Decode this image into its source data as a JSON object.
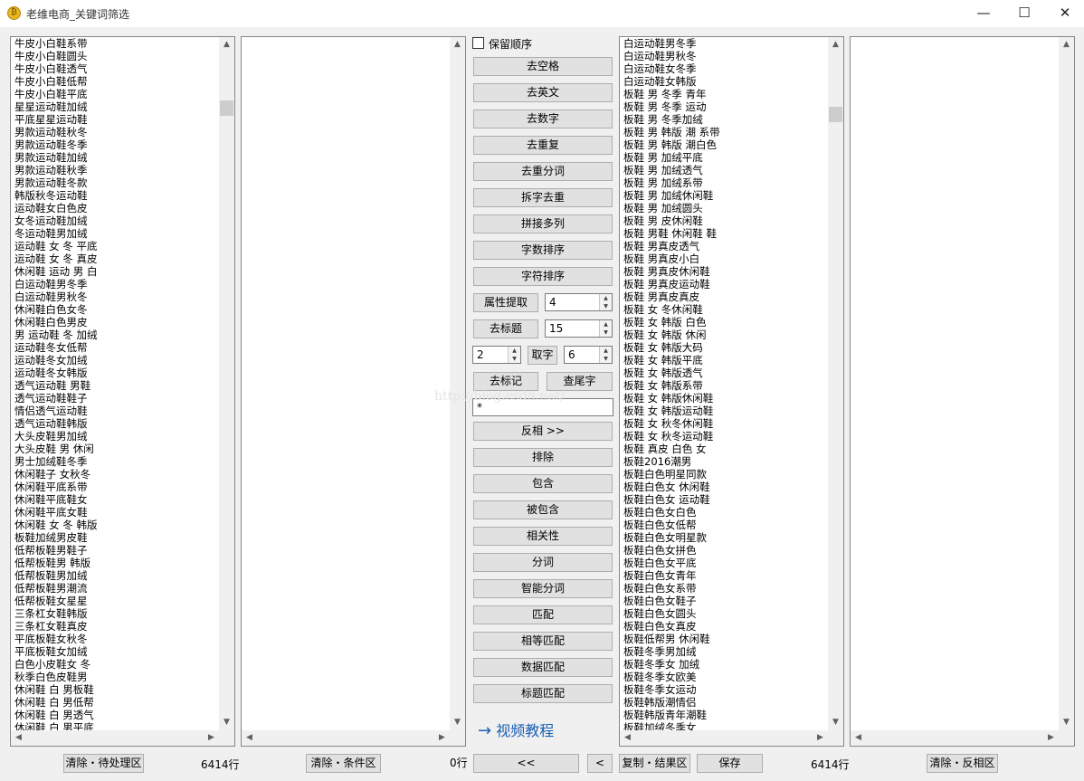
{
  "window": {
    "title": "老维电商_关键词筛选",
    "icon": "app-logo-icon",
    "minimize": "—",
    "maximize": "☐",
    "close": "✕"
  },
  "left_list": {
    "items": [
      "牛皮小白鞋系带",
      "牛皮小白鞋圆头",
      "牛皮小白鞋透气",
      "牛皮小白鞋低帮",
      "牛皮小白鞋平底",
      "星星运动鞋加绒",
      "平底星星运动鞋",
      "男款运动鞋秋冬",
      "男款运动鞋冬季",
      "男款运动鞋加绒",
      "男款运动鞋秋季",
      "男款运动鞋冬款",
      "韩版秋冬运动鞋",
      "运动鞋女白色皮",
      "女冬运动鞋加绒",
      "冬运动鞋男加绒",
      "运动鞋 女 冬 平底",
      "运动鞋 女 冬 真皮",
      "休闲鞋 运动 男 白",
      "白运动鞋男冬季",
      "白运动鞋男秋冬",
      "休闲鞋白色女冬",
      "休闲鞋白色男皮",
      "男 运动鞋 冬 加绒",
      "运动鞋冬女低帮",
      "运动鞋冬女加绒",
      "运动鞋冬女韩版",
      "透气运动鞋 男鞋",
      "透气运动鞋鞋子",
      "情侣透气运动鞋",
      "透气运动鞋韩版",
      "大头皮鞋男加绒",
      "大头皮鞋 男 休闲",
      "男士加绒鞋冬季",
      "休闲鞋子 女秋冬",
      "休闲鞋平底系带",
      "休闲鞋平底鞋女",
      "休闲鞋平底女鞋",
      "休闲鞋 女 冬 韩版",
      "板鞋加绒男皮鞋",
      "低帮板鞋男鞋子",
      "低帮板鞋男 韩版",
      "低帮板鞋男加绒",
      "低帮板鞋男潮流",
      "低帮板鞋女星星",
      "三条杠女鞋韩版",
      "三条杠女鞋真皮",
      "平底板鞋女秋冬",
      "平底板鞋女加绒",
      "白色小皮鞋女 冬",
      "秋季白色皮鞋男",
      "休闲鞋 白 男板鞋",
      "休闲鞋 白 男低帮",
      "休闲鞋 白 男透气",
      "休闲鞋 白 男平底"
    ]
  },
  "right_list": {
    "items": [
      "白运动鞋男冬季",
      "白运动鞋男秋冬",
      "白运动鞋女冬季",
      "白运动鞋女韩版",
      "板鞋 男 冬季 青年",
      "板鞋 男 冬季 运动",
      "板鞋 男 冬季加绒",
      "板鞋 男 韩版 潮 系带",
      "板鞋 男 韩版 潮白色",
      "板鞋 男 加绒平底",
      "板鞋 男 加绒透气",
      "板鞋 男 加绒系带",
      "板鞋 男 加绒休闲鞋",
      "板鞋 男 加绒圆头",
      "板鞋 男 皮休闲鞋",
      "板鞋 男鞋 休闲鞋 鞋",
      "板鞋 男真皮透气",
      "板鞋 男真皮小白",
      "板鞋 男真皮休闲鞋",
      "板鞋 男真皮运动鞋",
      "板鞋 男真皮真皮",
      "板鞋 女 冬休闲鞋",
      "板鞋 女 韩版 白色",
      "板鞋 女 韩版 休闲",
      "板鞋 女 韩版大码",
      "板鞋 女 韩版平底",
      "板鞋 女 韩版透气",
      "板鞋 女 韩版系带",
      "板鞋 女 韩版休闲鞋",
      "板鞋 女 韩版运动鞋",
      "板鞋 女 秋冬休闲鞋",
      "板鞋 女 秋冬运动鞋",
      "板鞋 真皮 白色 女",
      "板鞋2016潮男",
      "板鞋白色明星同款",
      "板鞋白色女 休闲鞋",
      "板鞋白色女 运动鞋",
      "板鞋白色女白色",
      "板鞋白色女低帮",
      "板鞋白色女明星款",
      "板鞋白色女拼色",
      "板鞋白色女平底",
      "板鞋白色女青年",
      "板鞋白色女系带",
      "板鞋白色女鞋子",
      "板鞋白色女圆头",
      "板鞋白色女真皮",
      "板鞋低帮男 休闲鞋",
      "板鞋冬季男加绒",
      "板鞋冬季女 加绒",
      "板鞋冬季女欧美",
      "板鞋冬季女运动",
      "板鞋韩版潮情侣",
      "板鞋韩版青年潮鞋",
      "板鞋加绒冬季女"
    ]
  },
  "middle": {
    "keep_order_label": "保留顺序",
    "buttons": {
      "remove_spaces": "去空格",
      "remove_english": "去英文",
      "remove_digits": "去数字",
      "remove_duplicates": "去重复",
      "dedupe_segments": "去重分词",
      "split_dedupe": "拆字去重",
      "join_columns": "拼接多列",
      "sort_by_length": "字数排序",
      "sort_by_char": "字符排序",
      "extract_attr": "属性提取",
      "remove_title": "去标题",
      "take_chars": "取字",
      "remove_marks": "去标记",
      "find_suffix": "查尾字",
      "reverse": "反相 >>",
      "exclude": "排除",
      "include": "包含",
      "included_by": "被包含",
      "relevance": "相关性",
      "segment": "分词",
      "smart_segment": "智能分词",
      "match": "匹配",
      "equal_match": "相等匹配",
      "data_match": "数据匹配",
      "title_match": "标题匹配"
    },
    "spins": {
      "attr": "4",
      "title": "15",
      "take_from": "2",
      "take_to": "6"
    },
    "pattern_input": "*",
    "video_link": "视频教程",
    "watermark": "http://blog.csdn.net/"
  },
  "bottom": {
    "clear_pending": "清除・待处理区",
    "pending_count": "6414行",
    "clear_condition": "清除・条件区",
    "condition_count": "0行",
    "back_all": "<<",
    "back_one": "<",
    "copy_result": "复制・结果区",
    "save": "保存",
    "result_count": "6414行",
    "clear_reverse": "清除・反相区"
  },
  "colors": {
    "window_bg": "#f0f0f0",
    "button_bg": "#e1e1e1",
    "link": "#1a5fb4"
  }
}
